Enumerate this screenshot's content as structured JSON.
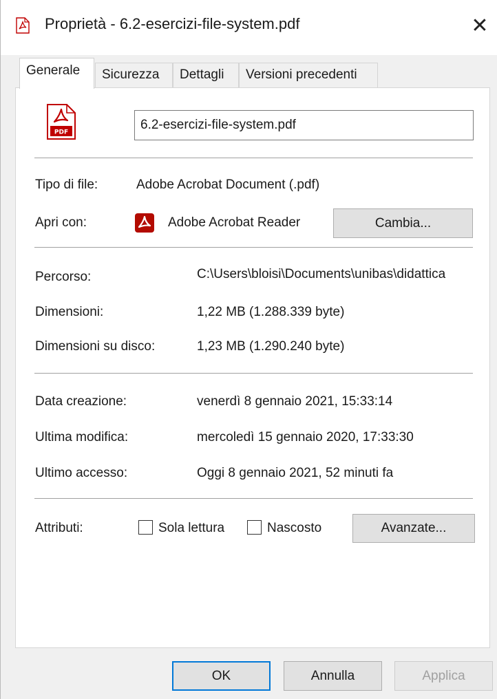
{
  "window": {
    "title": "Proprietà - 6.2-esercizi-file-system.pdf",
    "close_glyph": "✕"
  },
  "tabs": [
    {
      "label": "Generale",
      "active": true
    },
    {
      "label": "Sicurezza",
      "active": false
    },
    {
      "label": "Dettagli",
      "active": false
    },
    {
      "label": "Versioni precedenti",
      "active": false
    }
  ],
  "file": {
    "name": "6.2-esercizi-file-system.pdf",
    "icon_text": "PDF"
  },
  "general": {
    "type_label": "Tipo di file:",
    "type_value": "Adobe Acrobat Document (.pdf)",
    "opens_label": "Apri con:",
    "opens_value": "Adobe Acrobat Reader",
    "change_button": "Cambia..."
  },
  "location": {
    "path_label": "Percorso:",
    "path_value": "C:\\Users\\bloisi\\Documents\\unibas\\didattica",
    "size_label": "Dimensioni:",
    "size_value": "1,22 MB (1.288.339 byte)",
    "disk_label": "Dimensioni su disco:",
    "disk_value": "1,23 MB (1.290.240 byte)"
  },
  "dates": {
    "created_label": "Data creazione:",
    "created_value": "venerdì 8 gennaio 2021, 15:33:14",
    "modified_label": "Ultima modifica:",
    "modified_value": "mercoledì 15 gennaio 2020, 17:33:30",
    "accessed_label": "Ultimo accesso:",
    "accessed_value": "Oggi 8 gennaio 2021, 52 minuti fa"
  },
  "attributes": {
    "label": "Attributi:",
    "readonly_label": "Sola lettura",
    "readonly_checked": false,
    "hidden_label": "Nascosto",
    "hidden_checked": false,
    "advanced_button": "Avanzate..."
  },
  "footer": {
    "ok": "OK",
    "cancel": "Annulla",
    "apply": "Applica"
  },
  "colors": {
    "acrobat_red": "#c00000",
    "focus_blue": "#0078d7"
  }
}
